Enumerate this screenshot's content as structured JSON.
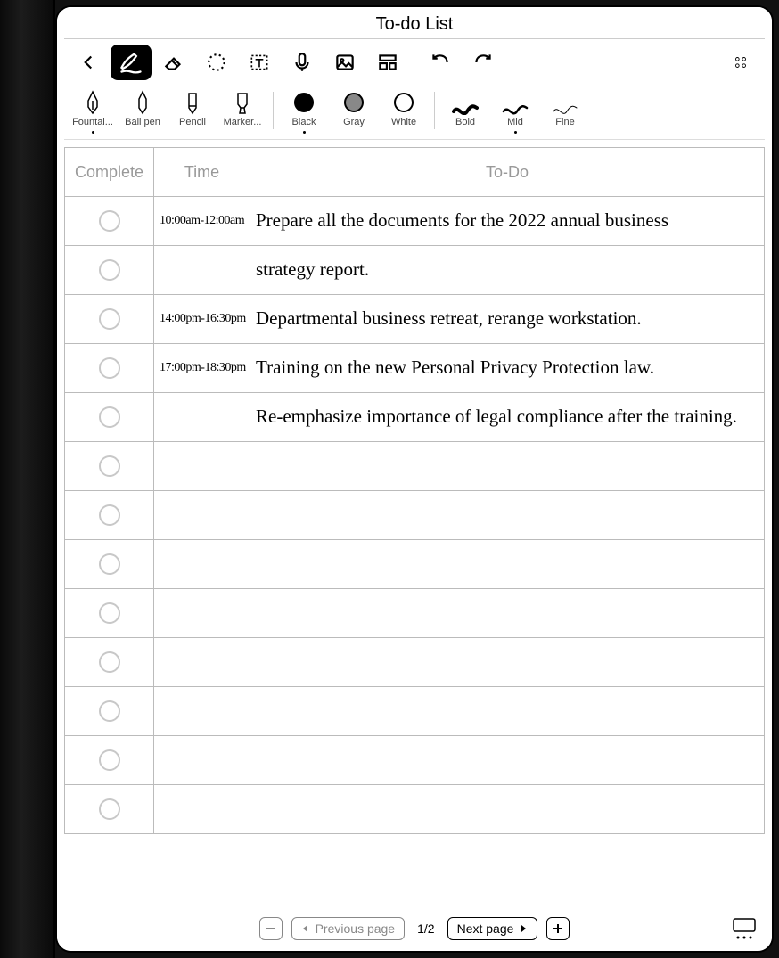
{
  "title": "To-do List",
  "toolbar1": {
    "back": "back",
    "pen": "pen",
    "eraser": "eraser",
    "lasso": "lasso",
    "text": "text",
    "mic": "mic",
    "image": "image",
    "layout": "layout",
    "undo": "undo",
    "redo": "redo",
    "more": "more"
  },
  "pens": {
    "fountain": "Fountai...",
    "ballpen": "Ball pen",
    "pencil": "Pencil",
    "marker": "Marker..."
  },
  "colors": {
    "black": "Black",
    "gray": "Gray",
    "white": "White"
  },
  "strokes": {
    "bold": "Bold",
    "mid": "Mid",
    "fine": "Fine"
  },
  "headers": {
    "complete": "Complete",
    "time": "Time",
    "todo": "To-Do"
  },
  "rows": [
    {
      "time": "10:00am-12:00am",
      "text": "Prepare all the documents for the 2022 annual business"
    },
    {
      "time": "",
      "text": "strategy report."
    },
    {
      "time": "14:00pm-16:30pm",
      "text": "Departmental business retreat, rerange workstation."
    },
    {
      "time": "17:00pm-18:30pm",
      "text": "Training on the new Personal Privacy Protection law."
    },
    {
      "time": "",
      "text": "Re-emphasize importance of legal compliance after the training."
    },
    {
      "time": "",
      "text": ""
    },
    {
      "time": "",
      "text": ""
    },
    {
      "time": "",
      "text": ""
    },
    {
      "time": "",
      "text": ""
    },
    {
      "time": "",
      "text": ""
    },
    {
      "time": "",
      "text": ""
    },
    {
      "time": "",
      "text": ""
    },
    {
      "time": "",
      "text": ""
    }
  ],
  "footer": {
    "prev": "Previous page",
    "next": "Next page",
    "page": "1/2"
  }
}
